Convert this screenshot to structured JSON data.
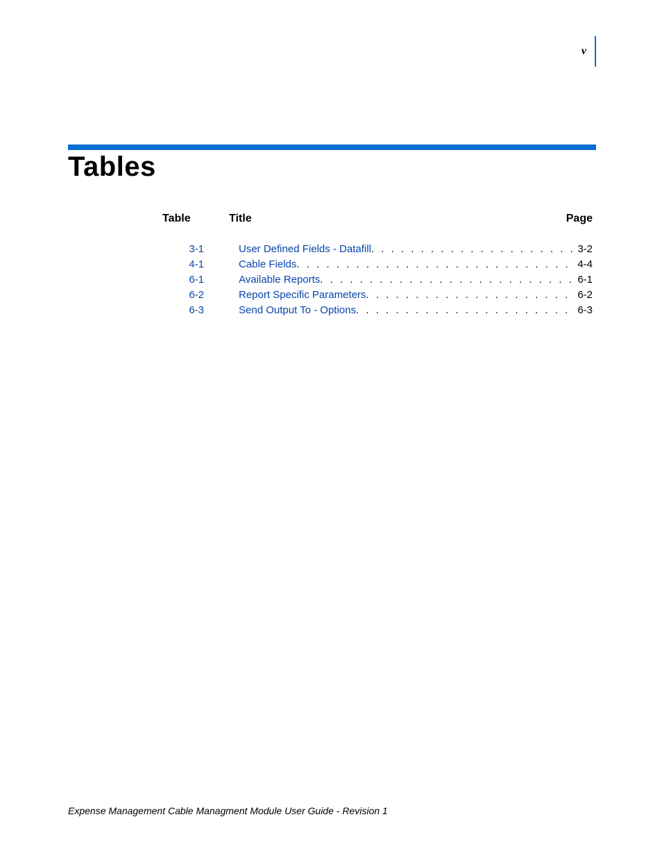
{
  "page_marker": "v",
  "heading": "Tables",
  "columns": {
    "table": "Table",
    "title": "Title",
    "page": "Page"
  },
  "entries": [
    {
      "num": "3-1",
      "title": "User Defined Fields - Datafill",
      "page": "3-2"
    },
    {
      "num": "4-1",
      "title": "Cable Fields",
      "page": "4-4"
    },
    {
      "num": "6-1",
      "title": "Available Reports",
      "page": "6-1"
    },
    {
      "num": "6-2",
      "title": "Report Specific Parameters",
      "page": "6-2"
    },
    {
      "num": "6-3",
      "title": "Send Output To - Options",
      "page": "6-3"
    }
  ],
  "footer": "Expense Management Cable Managment Module User Guide - Revision 1"
}
